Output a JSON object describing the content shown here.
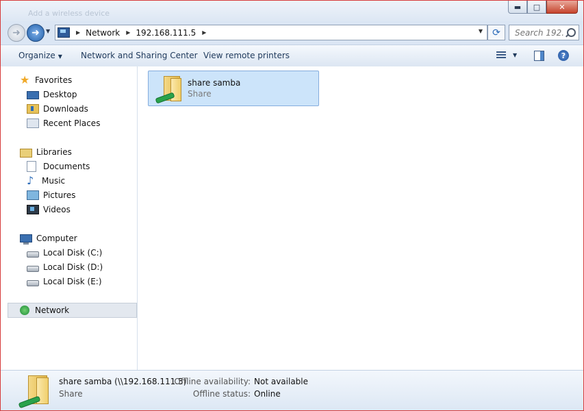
{
  "window": {
    "ghost_title": "Add a wireless device",
    "buttons": {
      "minimize": "▬",
      "maximize": "□",
      "close": "✕"
    }
  },
  "address_bar": {
    "crumbs": [
      "Network",
      "192.168.111.5"
    ],
    "search_placeholder": "Search 192...."
  },
  "toolbar": {
    "organize": "Organize",
    "network_sharing_center": "Network and Sharing Center",
    "view_remote_printers": "View remote printers"
  },
  "nav_pane": {
    "favorites": {
      "label": "Favorites",
      "items": [
        "Desktop",
        "Downloads",
        "Recent Places"
      ]
    },
    "libraries": {
      "label": "Libraries",
      "items": [
        "Documents",
        "Music",
        "Pictures",
        "Videos"
      ]
    },
    "computer": {
      "label": "Computer",
      "items": [
        "Local Disk (C:)",
        "Local Disk (D:)",
        "Local Disk (E:)"
      ]
    },
    "network": {
      "label": "Network",
      "selected": true
    }
  },
  "content": {
    "items": [
      {
        "name": "share samba",
        "type": "Share",
        "icon": "shared-folder-icon",
        "selected": true
      }
    ]
  },
  "details": {
    "name": "share samba (\\\\192.168.111.5)",
    "type": "Share",
    "offline_availability_label": "Offline availability:",
    "offline_availability_value": "Not available",
    "offline_status_label": "Offline status:",
    "offline_status_value": "Online"
  },
  "colors": {
    "window_border": "#d63a3a",
    "selection": "#cce4fa",
    "toolbar_text": "#1e395b"
  }
}
